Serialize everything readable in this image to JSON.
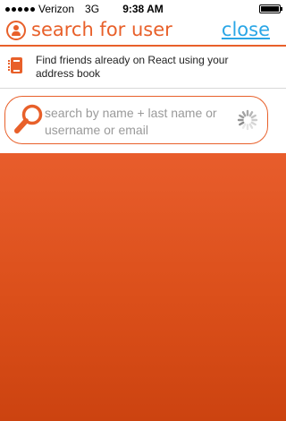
{
  "status_bar": {
    "carrier": "Verizon",
    "network": "3G",
    "time": "9:38 AM",
    "signal_bars": 5
  },
  "header": {
    "title": "search for user",
    "close_label": "close",
    "icon": "user-circle-icon"
  },
  "address_book": {
    "text": "Find friends already on React using your address book",
    "icon": "address-book-icon"
  },
  "search": {
    "placeholder": "search by name + last name or username or email",
    "value": "",
    "icon": "magnifier-icon",
    "loading": true
  },
  "colors": {
    "accent": "#e8602a",
    "link": "#2aa6e6",
    "overlay": "#db4f1a"
  }
}
